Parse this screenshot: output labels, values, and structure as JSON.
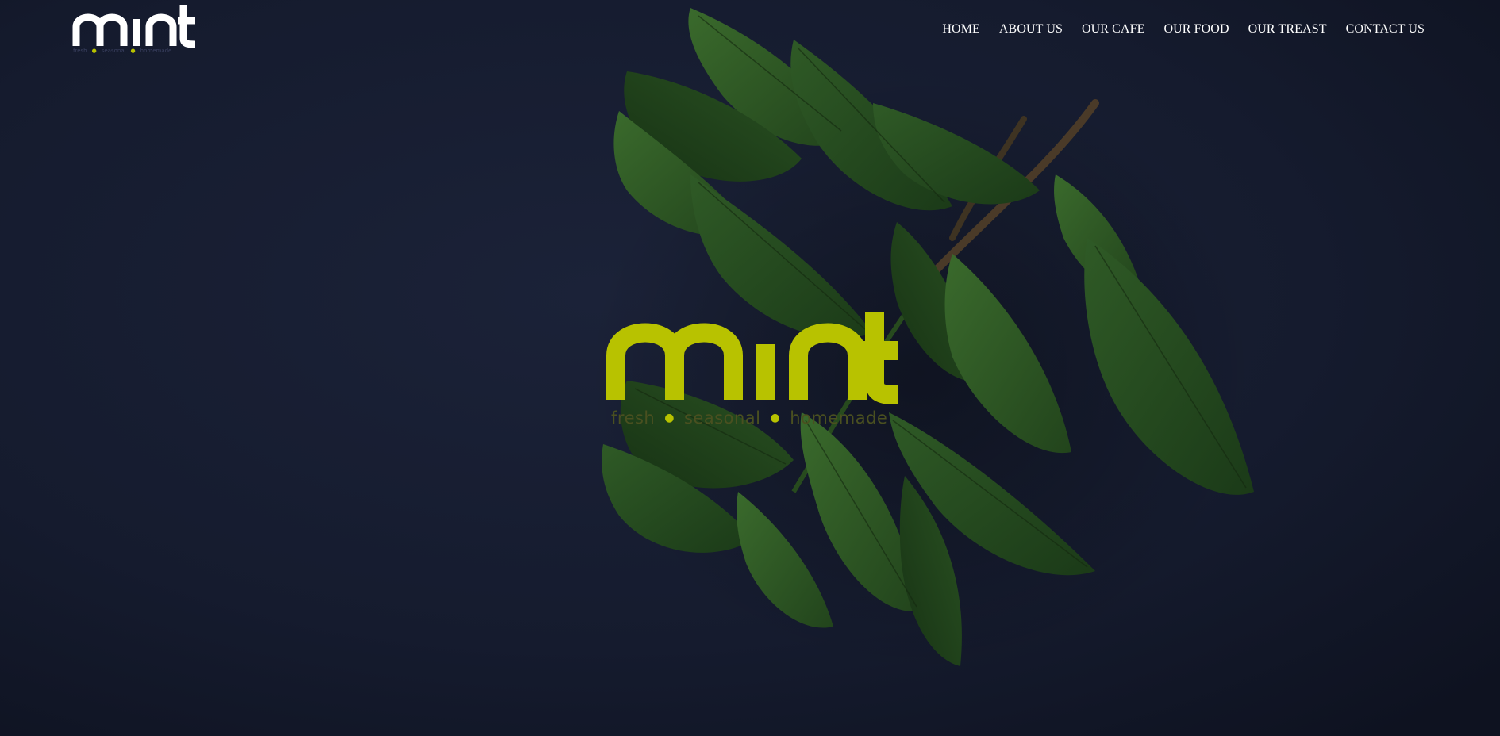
{
  "brand": {
    "logo_text": "mint",
    "tagline_words": [
      "fresh",
      "seasonal",
      "homemade"
    ],
    "accent_color": "#b8c200",
    "logo_color_header": "#ffffff"
  },
  "nav": {
    "items": [
      {
        "label": "HOME"
      },
      {
        "label": "ABOUT US"
      },
      {
        "label": "OUR CAFE"
      },
      {
        "label": "OUR FOOD"
      },
      {
        "label": "OUR TREAST"
      },
      {
        "label": "CONTACT US"
      }
    ]
  },
  "hero": {
    "background_color": "#141a2c",
    "leaf_color": "#244a22",
    "image_subject": "mint-leaves"
  }
}
